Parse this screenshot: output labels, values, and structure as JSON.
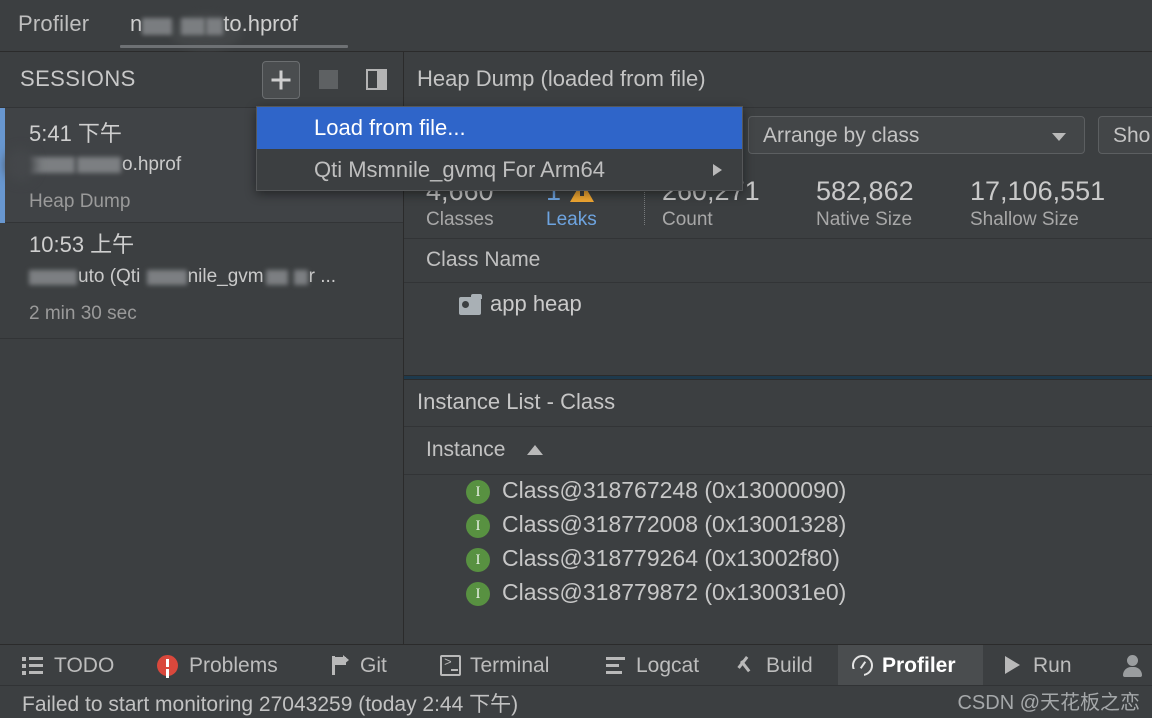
{
  "titlebar": {
    "app_label": "Profiler",
    "tab": {
      "prefix": "n",
      "suffix": "to.hprof",
      "redacted": true
    }
  },
  "sessions": {
    "title": "SESSIONS",
    "buttons": [
      {
        "name": "add-session",
        "icon": "plus-icon",
        "label": "+"
      },
      {
        "name": "stop-session",
        "icon": "stop-square-icon",
        "label": ""
      },
      {
        "name": "toggle-sessions-panel",
        "icon": "split-panel-icon",
        "label": ""
      }
    ],
    "items": [
      {
        "time": "5:41 下午",
        "subtitle_suffix": "o.hprof",
        "meta": "Heap Dump",
        "selected": true
      },
      {
        "time": "10:53 上午",
        "subtitle_pre": "uto (Qti ",
        "subtitle_mid": "nile_gvm",
        "subtitle_post": "r ...",
        "meta": "2 min 30 sec",
        "selected": false
      }
    ]
  },
  "popup": {
    "items": [
      {
        "label": "Load from file...",
        "highlighted": true,
        "submenu": false
      },
      {
        "label": "Qti Msmnile_gvmq For Arm64",
        "highlighted": false,
        "submenu": true
      }
    ]
  },
  "content": {
    "header_title": "Heap Dump (loaded from file)",
    "toolbar": {
      "arrange_select": "Arrange by class",
      "show_button": "Sho"
    },
    "stats": [
      {
        "value": "4,660",
        "label": "Classes",
        "accent": false,
        "warning": false
      },
      {
        "value": "1",
        "label": "Leaks",
        "accent": true,
        "warning": true
      },
      {
        "value": "260,271",
        "label": "Count",
        "accent": false,
        "warning": false
      },
      {
        "value": "582,862",
        "label": "Native Size",
        "accent": false,
        "warning": false
      },
      {
        "value": "17,106,551",
        "label": "Shallow Size",
        "accent": false,
        "warning": false
      }
    ],
    "class_table": {
      "column_header": "Class Name",
      "rows": [
        {
          "label": "app heap",
          "icon": "heap-folder-icon"
        }
      ]
    },
    "instance_list": {
      "title": "Instance List - Class",
      "column_header": "Instance",
      "sort": "ascending",
      "rows": [
        {
          "label": "Class@318767248 (0x13000090)"
        },
        {
          "label": "Class@318772008 (0x13001328)"
        },
        {
          "label": "Class@318779264 (0x13002f80)"
        },
        {
          "label": "Class@318779872 (0x130031e0)"
        }
      ]
    }
  },
  "toolwindow_bar": {
    "items": [
      {
        "label": "TODO",
        "icon": "todo-list-icon",
        "active": false
      },
      {
        "label": "Problems",
        "icon": "problems-error-icon",
        "active": false
      },
      {
        "label": "Git",
        "icon": "git-branch-icon",
        "active": false
      },
      {
        "label": "Terminal",
        "icon": "terminal-icon",
        "active": false
      },
      {
        "label": "Logcat",
        "icon": "logcat-icon",
        "active": false
      },
      {
        "label": "Build",
        "icon": "build-hammer-icon",
        "active": false
      },
      {
        "label": "Profiler",
        "icon": "profiler-gauge-icon",
        "active": true
      },
      {
        "label": "Run",
        "icon": "run-play-icon",
        "active": false
      }
    ]
  },
  "statusbar": {
    "message": "Failed to start monitoring 27043259 (today 2:44 下午)",
    "watermark": "CSDN @天花板之恋"
  },
  "colors": {
    "background": "#3c3f41",
    "selection_blue": "#2f65c9",
    "session_indicator": "#6897d0",
    "accent_blue": "#6ea4e0",
    "warning_orange": "#f0a732",
    "error_red": "#d9483c",
    "instance_green": "#589141",
    "splitter_teal": "#1e3a4d"
  }
}
